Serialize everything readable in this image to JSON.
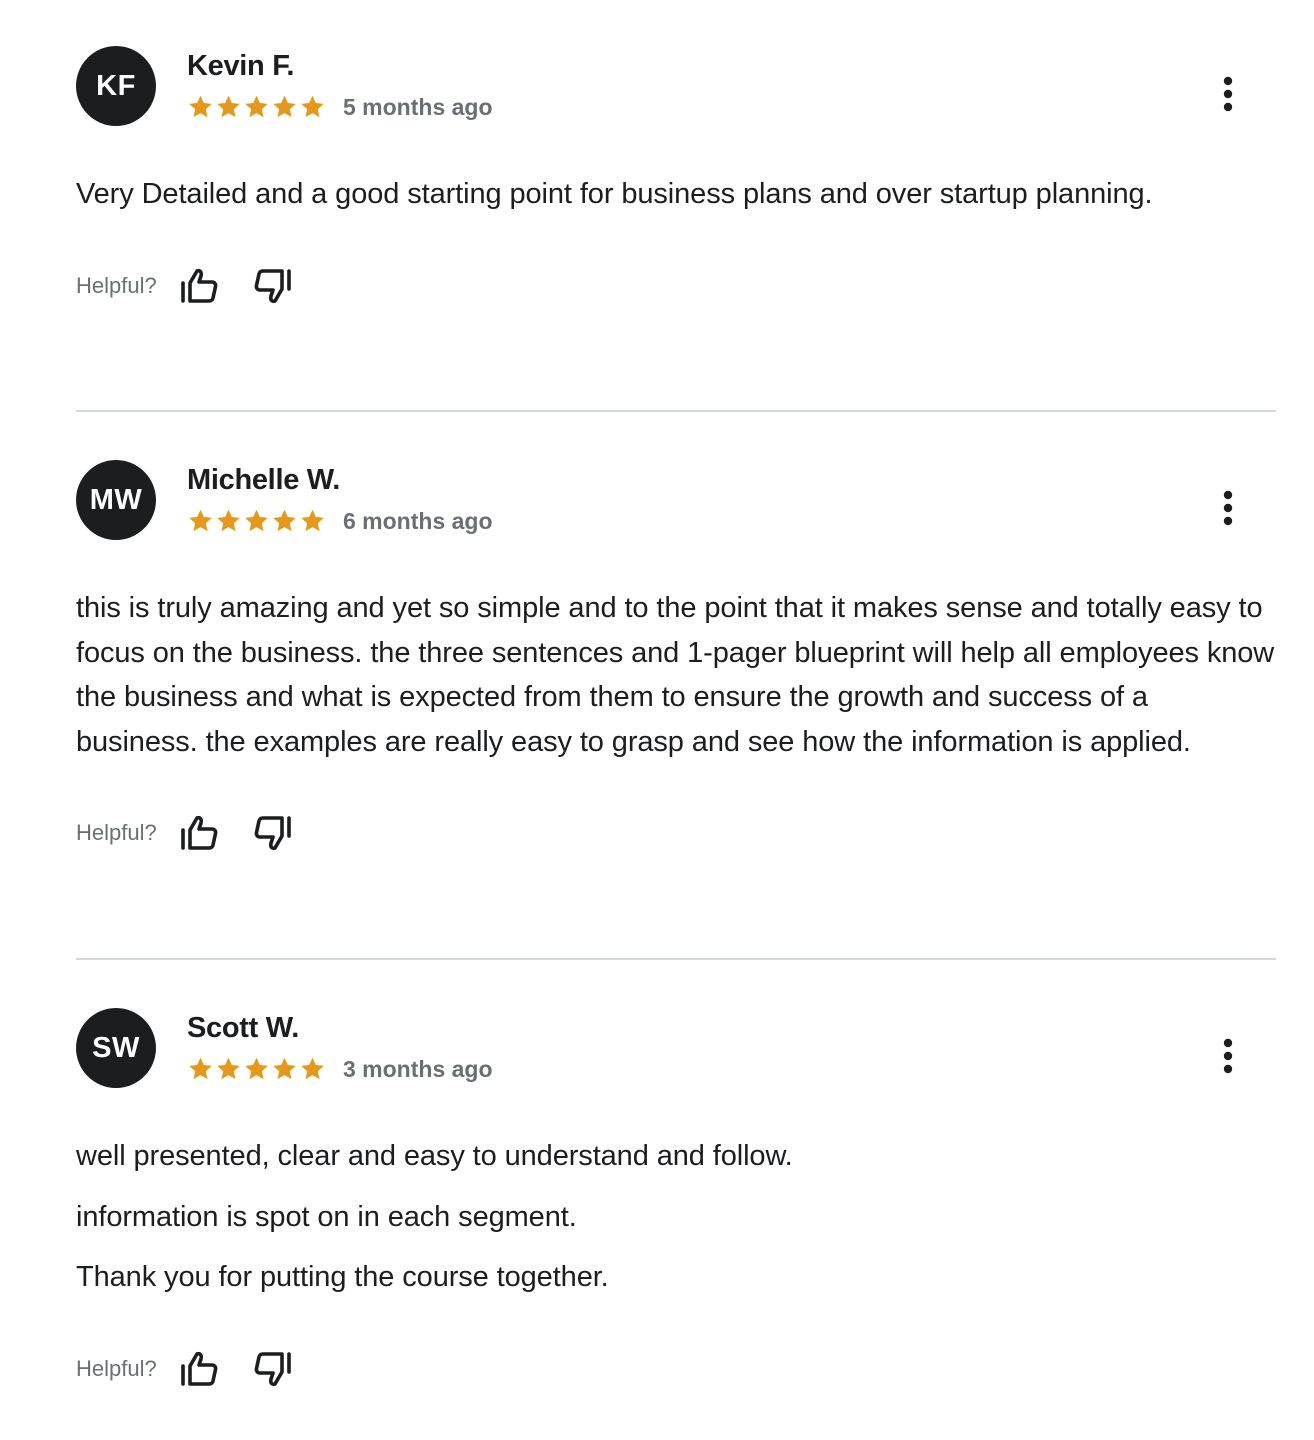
{
  "colors": {
    "star": "#e59819",
    "avatar_bg": "#1c1d1f",
    "text": "#1c1d1f",
    "muted": "#6a6f73",
    "divider": "#d1d7dc"
  },
  "helpful_label": "Helpful?",
  "reviews": [
    {
      "initials": "KF",
      "name": "Kevin F.",
      "rating": 5,
      "date": "5 months ago",
      "paragraphs": [
        "Very Detailed and a good starting point for business plans and over startup planning."
      ]
    },
    {
      "initials": "MW",
      "name": "Michelle W.",
      "rating": 5,
      "date": "6 months ago",
      "paragraphs": [
        "this is truly amazing and yet so simple and to the point that it makes sense and totally easy to focus on the business. the three sentences and 1-pager blueprint will help all employees know the business and what is expected from them to ensure the growth and success of a business. the examples are really easy to grasp and see how the information is applied."
      ]
    },
    {
      "initials": "SW",
      "name": "Scott W.",
      "rating": 5,
      "date": "3 months ago",
      "paragraphs": [
        "well presented, clear and easy to understand and follow.",
        "information is spot on in each segment.",
        "Thank you for putting the course together."
      ]
    }
  ],
  "icons": {
    "star": "star-icon",
    "more": "more-vertical-icon",
    "thumbs_up": "thumbs-up-icon",
    "thumbs_down": "thumbs-down-icon"
  }
}
